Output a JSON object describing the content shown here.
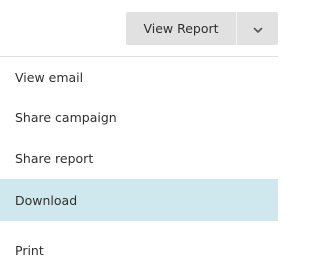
{
  "toolbar": {
    "view_report_label": "View Report",
    "caret_icon": "chevron-down-icon"
  },
  "menu": {
    "items": [
      {
        "label": "View email"
      },
      {
        "label": "Share campaign"
      },
      {
        "label": "Share report"
      },
      {
        "label": "Download",
        "highlighted": true
      },
      {
        "label": "Print"
      }
    ]
  },
  "colors": {
    "button_bg": "#e1e1e1",
    "highlight_bg": "#cfe8ee",
    "text": "#303030"
  }
}
